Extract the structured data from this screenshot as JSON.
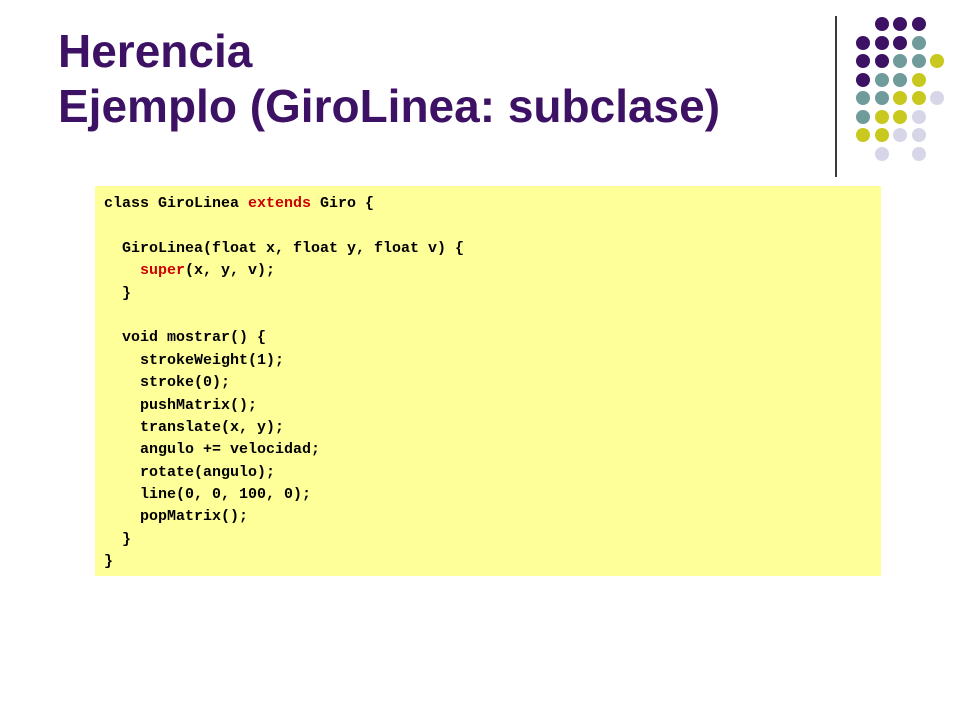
{
  "title": {
    "line1": "Herencia",
    "line2": "Ejemplo (GiroLinea: subclase)"
  },
  "colors": {
    "title": "#3d1265",
    "code_background": "#ffff99",
    "keyword": "#cc0000",
    "dot_purple": "#3d1265",
    "dot_teal": "#6f9b9b",
    "dot_olive": "#c8c81e",
    "dot_lavender": "#d6d6e8"
  },
  "code": [
    [
      "class GiroLinea ",
      {
        "kw": "extends"
      },
      " Giro {"
    ],
    [
      ""
    ],
    [
      "  GiroLinea(float x, float y, float v) {"
    ],
    [
      "    ",
      {
        "kw": "super"
      },
      "(x, y, v);"
    ],
    [
      "  }"
    ],
    [
      ""
    ],
    [
      "  void mostrar() {"
    ],
    [
      "    strokeWeight(1);"
    ],
    [
      "    stroke(0);"
    ],
    [
      "    pushMatrix();"
    ],
    [
      "    translate(x, y);"
    ],
    [
      "    angulo += velocidad;"
    ],
    [
      "    rotate(angulo);"
    ],
    [
      "    line(0, 0, 100, 0);"
    ],
    [
      "    popMatrix();"
    ],
    [
      "  }"
    ],
    [
      "}"
    ]
  ],
  "dot_pattern": [
    [
      "",
      "purple",
      "purple",
      "purple",
      ""
    ],
    [
      "purple",
      "purple",
      "purple",
      "teal",
      ""
    ],
    [
      "purple",
      "purple",
      "teal",
      "teal",
      "olive"
    ],
    [
      "purple",
      "teal",
      "teal",
      "olive",
      ""
    ],
    [
      "teal",
      "teal",
      "olive",
      "olive",
      "lavender"
    ],
    [
      "teal",
      "olive",
      "olive",
      "lavender",
      ""
    ],
    [
      "olive",
      "olive",
      "lavender",
      "lavender",
      ""
    ],
    [
      "",
      "lavender",
      "",
      "lavender",
      ""
    ]
  ]
}
